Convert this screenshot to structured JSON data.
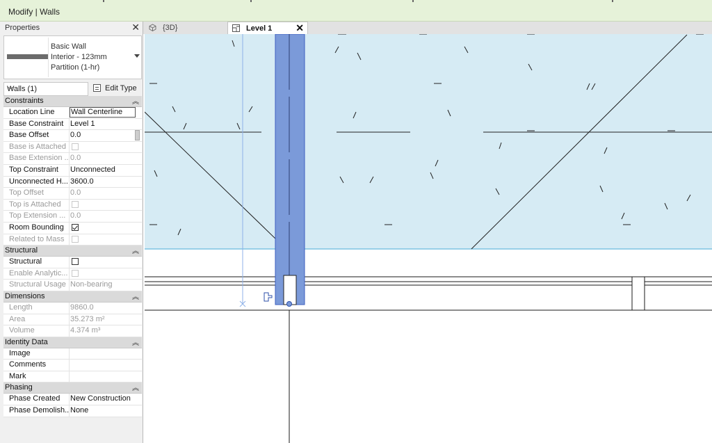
{
  "ribbon": {
    "title": "Modify | Walls"
  },
  "properties": {
    "title": "Properties",
    "type_lines": [
      "Basic Wall",
      "Interior - 123mm",
      "Partition (1-hr)"
    ],
    "filter": "Walls (1)",
    "edit_type": "Edit Type",
    "sections": [
      {
        "name": "Constraints",
        "rows": [
          {
            "key": "Location Line",
            "value": "Wall Centerline",
            "boxed": true
          },
          {
            "key": "Base Constraint",
            "value": "Level 1"
          },
          {
            "key": "Base Offset",
            "value": "0.0"
          },
          {
            "key": "Base is Attached",
            "checkbox": false,
            "disabled": true
          },
          {
            "key": "Base Extension ...",
            "value": "0.0",
            "disabled": true
          },
          {
            "key": "Top Constraint",
            "value": "Unconnected"
          },
          {
            "key": "Unconnected H...",
            "value": "3600.0"
          },
          {
            "key": "Top Offset",
            "value": "0.0",
            "disabled": true
          },
          {
            "key": "Top is Attached",
            "checkbox": false,
            "disabled": true
          },
          {
            "key": "Top Extension ...",
            "value": "0.0",
            "disabled": true
          },
          {
            "key": "Room Bounding",
            "checkbox": true
          },
          {
            "key": "Related to Mass",
            "checkbox": false,
            "disabled": true
          }
        ]
      },
      {
        "name": "Structural",
        "rows": [
          {
            "key": "Structural",
            "checkbox": false
          },
          {
            "key": "Enable Analytic...",
            "checkbox": false,
            "disabled": true
          },
          {
            "key": "Structural Usage",
            "value": "Non-bearing",
            "disabled": true
          }
        ]
      },
      {
        "name": "Dimensions",
        "rows": [
          {
            "key": "Length",
            "value": "9860.0",
            "disabled": true
          },
          {
            "key": "Area",
            "value": "35.273 m²",
            "disabled": true
          },
          {
            "key": "Volume",
            "value": "4.374 m³",
            "disabled": true
          }
        ]
      },
      {
        "name": "Identity Data",
        "rows": [
          {
            "key": "Image",
            "value": ""
          },
          {
            "key": "Comments",
            "value": ""
          },
          {
            "key": "Mark",
            "value": ""
          }
        ]
      },
      {
        "name": "Phasing",
        "rows": [
          {
            "key": "Phase Created",
            "value": "New Construction"
          },
          {
            "key": "Phase Demolish...",
            "value": "None"
          }
        ]
      }
    ]
  },
  "tabs": [
    {
      "label": "{3D}",
      "active": false
    },
    {
      "label": "Level 1",
      "active": true
    }
  ],
  "colors": {
    "ribbon_bg": "#e6f2d9",
    "room_fill": "#d6ebf4",
    "selected_wall": "#7b9ad9",
    "selection_edge": "#3d5fbf",
    "room_boundary": "#66b9dd"
  }
}
